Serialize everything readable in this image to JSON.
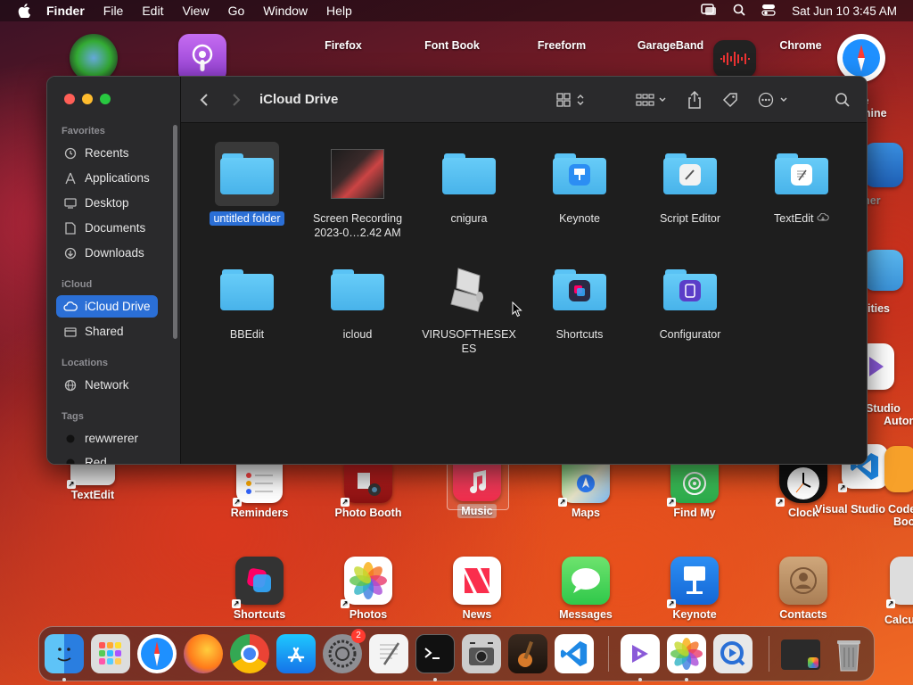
{
  "menubar": {
    "app": "Finder",
    "items": [
      "File",
      "Edit",
      "View",
      "Go",
      "Window",
      "Help"
    ],
    "clock": "Sat Jun 10  3:45 AM"
  },
  "desktop": {
    "top_row": [
      "Firefox",
      "Font Book",
      "Freeform",
      "GarageBand",
      "Chrome"
    ],
    "right_col": [
      "ore",
      "achine",
      "ather",
      "ities",
      "Studio",
      "Autom",
      "Code",
      "Boo"
    ],
    "row1": [
      "TextEdit",
      "Reminders",
      "Photo Booth",
      "Music",
      "Maps",
      "Find My",
      "Clock",
      "Visual Studio"
    ],
    "row2": [
      "Shortcuts",
      "Photos",
      "News",
      "Messages",
      "Keynote",
      "Contacts",
      "Calcu"
    ]
  },
  "finder": {
    "title": "iCloud Drive",
    "sidebar": {
      "favorites_heading": "Favorites",
      "favorites": [
        "Recents",
        "Applications",
        "Desktop",
        "Documents",
        "Downloads"
      ],
      "icloud_heading": "iCloud",
      "icloud": [
        "iCloud Drive",
        "Shared"
      ],
      "locations_heading": "Locations",
      "locations": [
        "Network"
      ],
      "tags_heading": "Tags",
      "tags": [
        "rewwrerer",
        "Red"
      ]
    },
    "files": [
      {
        "name": "untitled folder"
      },
      {
        "name": "Screen Recording\n2023-0…2.42 AM"
      },
      {
        "name": "cnigura"
      },
      {
        "name": "Keynote"
      },
      {
        "name": "Script Editor"
      },
      {
        "name": "TextEdit"
      },
      {
        "name": "BBEdit"
      },
      {
        "name": "icloud"
      },
      {
        "name": "VIRUSOFTHESEX\nES"
      },
      {
        "name": "Shortcuts"
      },
      {
        "name": "Configurator"
      }
    ]
  },
  "dock": {
    "settings_badge": "2"
  },
  "colors": {
    "accent": "#2b6fd6",
    "folder": "#5ac3f5",
    "close": "#ff5f57",
    "minimize": "#febc2e",
    "zoom": "#28c840"
  }
}
